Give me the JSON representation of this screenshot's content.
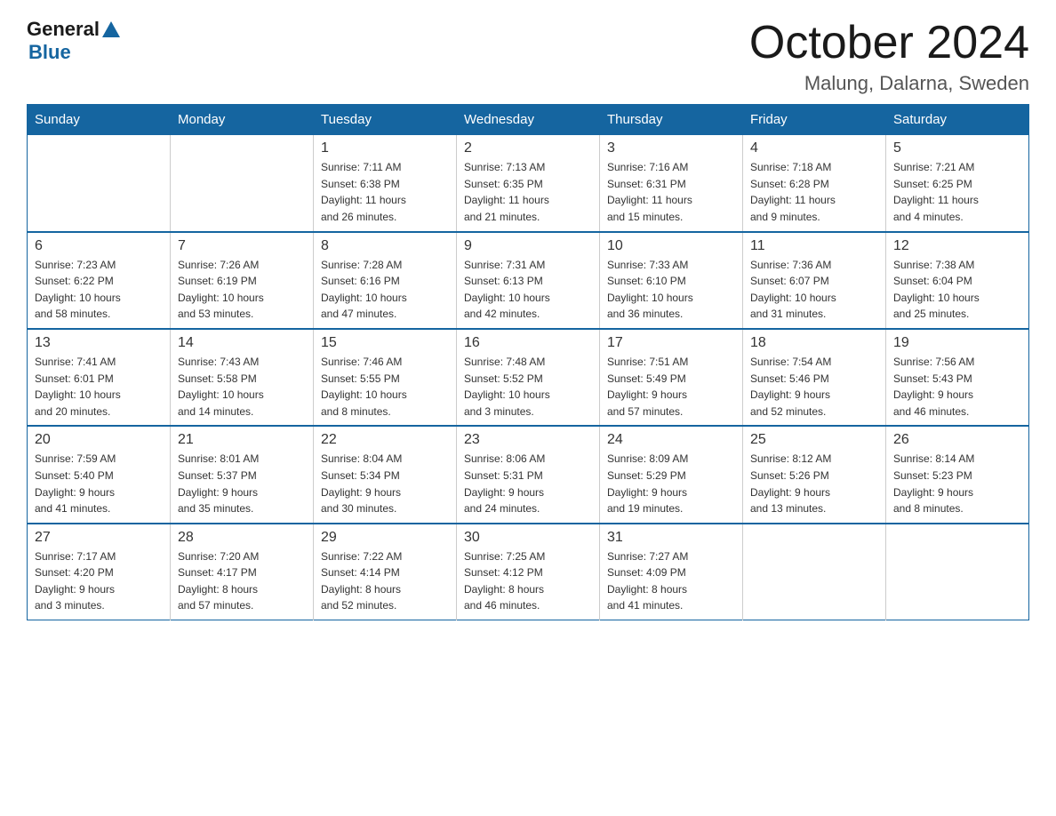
{
  "logo": {
    "general": "General",
    "blue": "Blue"
  },
  "title": "October 2024",
  "location": "Malung, Dalarna, Sweden",
  "days_of_week": [
    "Sunday",
    "Monday",
    "Tuesday",
    "Wednesday",
    "Thursday",
    "Friday",
    "Saturday"
  ],
  "weeks": [
    [
      {
        "day": "",
        "info": ""
      },
      {
        "day": "",
        "info": ""
      },
      {
        "day": "1",
        "info": "Sunrise: 7:11 AM\nSunset: 6:38 PM\nDaylight: 11 hours\nand 26 minutes."
      },
      {
        "day": "2",
        "info": "Sunrise: 7:13 AM\nSunset: 6:35 PM\nDaylight: 11 hours\nand 21 minutes."
      },
      {
        "day": "3",
        "info": "Sunrise: 7:16 AM\nSunset: 6:31 PM\nDaylight: 11 hours\nand 15 minutes."
      },
      {
        "day": "4",
        "info": "Sunrise: 7:18 AM\nSunset: 6:28 PM\nDaylight: 11 hours\nand 9 minutes."
      },
      {
        "day": "5",
        "info": "Sunrise: 7:21 AM\nSunset: 6:25 PM\nDaylight: 11 hours\nand 4 minutes."
      }
    ],
    [
      {
        "day": "6",
        "info": "Sunrise: 7:23 AM\nSunset: 6:22 PM\nDaylight: 10 hours\nand 58 minutes."
      },
      {
        "day": "7",
        "info": "Sunrise: 7:26 AM\nSunset: 6:19 PM\nDaylight: 10 hours\nand 53 minutes."
      },
      {
        "day": "8",
        "info": "Sunrise: 7:28 AM\nSunset: 6:16 PM\nDaylight: 10 hours\nand 47 minutes."
      },
      {
        "day": "9",
        "info": "Sunrise: 7:31 AM\nSunset: 6:13 PM\nDaylight: 10 hours\nand 42 minutes."
      },
      {
        "day": "10",
        "info": "Sunrise: 7:33 AM\nSunset: 6:10 PM\nDaylight: 10 hours\nand 36 minutes."
      },
      {
        "day": "11",
        "info": "Sunrise: 7:36 AM\nSunset: 6:07 PM\nDaylight: 10 hours\nand 31 minutes."
      },
      {
        "day": "12",
        "info": "Sunrise: 7:38 AM\nSunset: 6:04 PM\nDaylight: 10 hours\nand 25 minutes."
      }
    ],
    [
      {
        "day": "13",
        "info": "Sunrise: 7:41 AM\nSunset: 6:01 PM\nDaylight: 10 hours\nand 20 minutes."
      },
      {
        "day": "14",
        "info": "Sunrise: 7:43 AM\nSunset: 5:58 PM\nDaylight: 10 hours\nand 14 minutes."
      },
      {
        "day": "15",
        "info": "Sunrise: 7:46 AM\nSunset: 5:55 PM\nDaylight: 10 hours\nand 8 minutes."
      },
      {
        "day": "16",
        "info": "Sunrise: 7:48 AM\nSunset: 5:52 PM\nDaylight: 10 hours\nand 3 minutes."
      },
      {
        "day": "17",
        "info": "Sunrise: 7:51 AM\nSunset: 5:49 PM\nDaylight: 9 hours\nand 57 minutes."
      },
      {
        "day": "18",
        "info": "Sunrise: 7:54 AM\nSunset: 5:46 PM\nDaylight: 9 hours\nand 52 minutes."
      },
      {
        "day": "19",
        "info": "Sunrise: 7:56 AM\nSunset: 5:43 PM\nDaylight: 9 hours\nand 46 minutes."
      }
    ],
    [
      {
        "day": "20",
        "info": "Sunrise: 7:59 AM\nSunset: 5:40 PM\nDaylight: 9 hours\nand 41 minutes."
      },
      {
        "day": "21",
        "info": "Sunrise: 8:01 AM\nSunset: 5:37 PM\nDaylight: 9 hours\nand 35 minutes."
      },
      {
        "day": "22",
        "info": "Sunrise: 8:04 AM\nSunset: 5:34 PM\nDaylight: 9 hours\nand 30 minutes."
      },
      {
        "day": "23",
        "info": "Sunrise: 8:06 AM\nSunset: 5:31 PM\nDaylight: 9 hours\nand 24 minutes."
      },
      {
        "day": "24",
        "info": "Sunrise: 8:09 AM\nSunset: 5:29 PM\nDaylight: 9 hours\nand 19 minutes."
      },
      {
        "day": "25",
        "info": "Sunrise: 8:12 AM\nSunset: 5:26 PM\nDaylight: 9 hours\nand 13 minutes."
      },
      {
        "day": "26",
        "info": "Sunrise: 8:14 AM\nSunset: 5:23 PM\nDaylight: 9 hours\nand 8 minutes."
      }
    ],
    [
      {
        "day": "27",
        "info": "Sunrise: 7:17 AM\nSunset: 4:20 PM\nDaylight: 9 hours\nand 3 minutes."
      },
      {
        "day": "28",
        "info": "Sunrise: 7:20 AM\nSunset: 4:17 PM\nDaylight: 8 hours\nand 57 minutes."
      },
      {
        "day": "29",
        "info": "Sunrise: 7:22 AM\nSunset: 4:14 PM\nDaylight: 8 hours\nand 52 minutes."
      },
      {
        "day": "30",
        "info": "Sunrise: 7:25 AM\nSunset: 4:12 PM\nDaylight: 8 hours\nand 46 minutes."
      },
      {
        "day": "31",
        "info": "Sunrise: 7:27 AM\nSunset: 4:09 PM\nDaylight: 8 hours\nand 41 minutes."
      },
      {
        "day": "",
        "info": ""
      },
      {
        "day": "",
        "info": ""
      }
    ]
  ]
}
